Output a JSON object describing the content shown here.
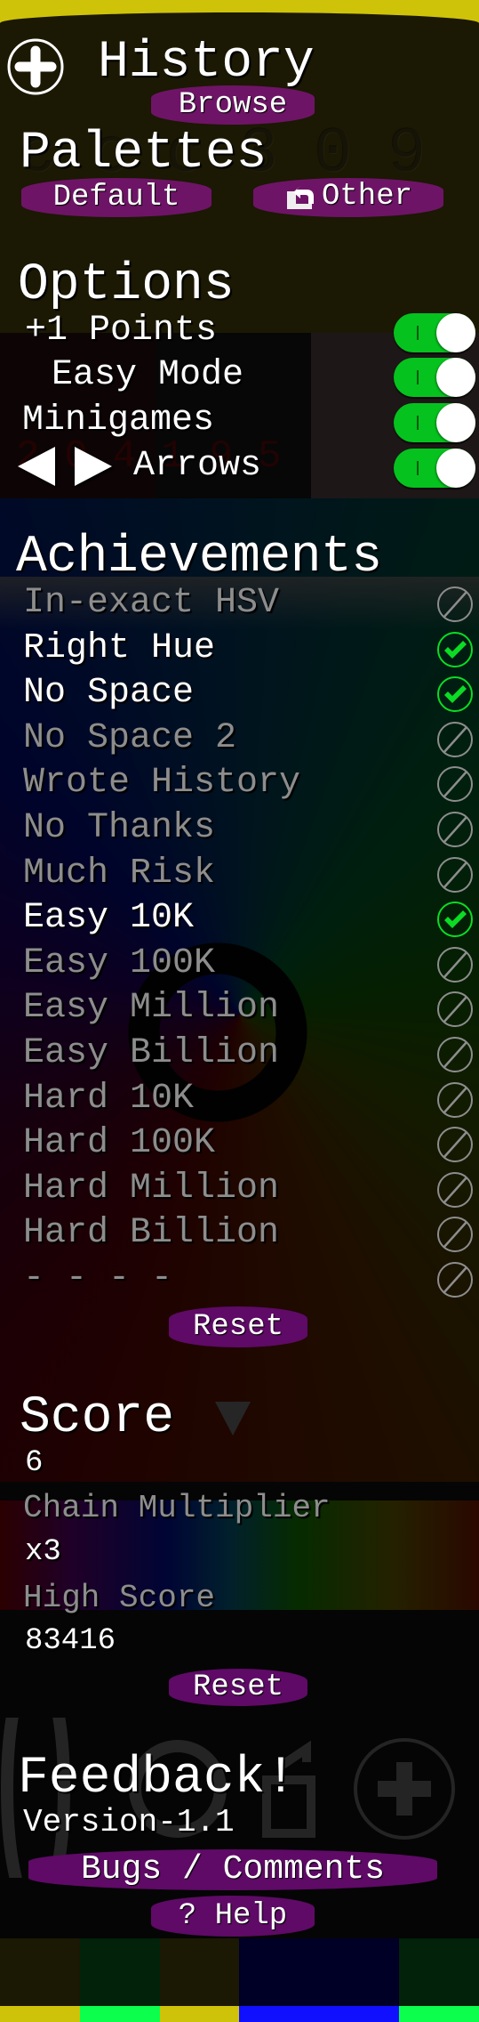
{
  "background": {
    "palette_code_digits": "ccc309",
    "options_code_digits": "204195",
    "swatches": [
      {
        "fill": "#1b1804",
        "strip": "#cfc30a"
      },
      {
        "fill": "#02220a",
        "strip": "#0bff4c"
      },
      {
        "fill": "#1b1804",
        "strip": "#cfc30a"
      },
      {
        "fill": "#000027",
        "strip": "#1010ff"
      },
      {
        "fill": "#000027",
        "strip": "#1010ff"
      },
      {
        "fill": "#02220a",
        "strip": "#0bff4c"
      }
    ]
  },
  "history": {
    "title": "History",
    "icon": "plus-circle-icon",
    "browse_label": "Browse"
  },
  "palettes": {
    "title": "Palettes",
    "default_label": "Default",
    "other_label": "Other",
    "other_icon": "palette-swap-icon"
  },
  "options": {
    "title": "Options",
    "items": [
      {
        "label": "+1 Points",
        "on": true
      },
      {
        "label": "Easy Mode",
        "on": true
      },
      {
        "label": "Minigames",
        "on": true
      },
      {
        "label": "Arrows",
        "icon": "left-right-arrows-icon",
        "on": true
      }
    ]
  },
  "achievements": {
    "title": "Achievements",
    "items": [
      {
        "label": "In-exact HSV",
        "unlocked": false
      },
      {
        "label": "Right Hue",
        "unlocked": true
      },
      {
        "label": "No Space",
        "unlocked": true
      },
      {
        "label": "No Space 2",
        "unlocked": false
      },
      {
        "label": "Wrote History",
        "unlocked": false
      },
      {
        "label": "No Thanks",
        "unlocked": false
      },
      {
        "label": "Much Risk",
        "unlocked": false
      },
      {
        "label": "Easy 10K",
        "unlocked": true
      },
      {
        "label": "Easy 100K",
        "unlocked": false
      },
      {
        "label": "Easy Million",
        "unlocked": false
      },
      {
        "label": "Easy Billion",
        "unlocked": false
      },
      {
        "label": "Hard 10K",
        "unlocked": false
      },
      {
        "label": "Hard 100K",
        "unlocked": false
      },
      {
        "label": "Hard Million",
        "unlocked": false
      },
      {
        "label": "Hard Billion",
        "unlocked": false
      },
      {
        "label": "- - - -",
        "unlocked": false
      }
    ],
    "reset_label": "Reset"
  },
  "score": {
    "title": "Score",
    "value": "6",
    "chain_label": "Chain Multiplier",
    "chain_value": "x3",
    "high_label": "High Score",
    "high_value": "83416",
    "reset_label": "Reset"
  },
  "feedback": {
    "title": "Feedback!",
    "version": "Version-1.1",
    "bugs_label": "Bugs / Comments",
    "help_label": "? Help"
  },
  "colors": {
    "button": "#6e1466",
    "toggle_on": "#06c21e",
    "check": "#0bdc24",
    "locked": "#8d8d8d"
  }
}
